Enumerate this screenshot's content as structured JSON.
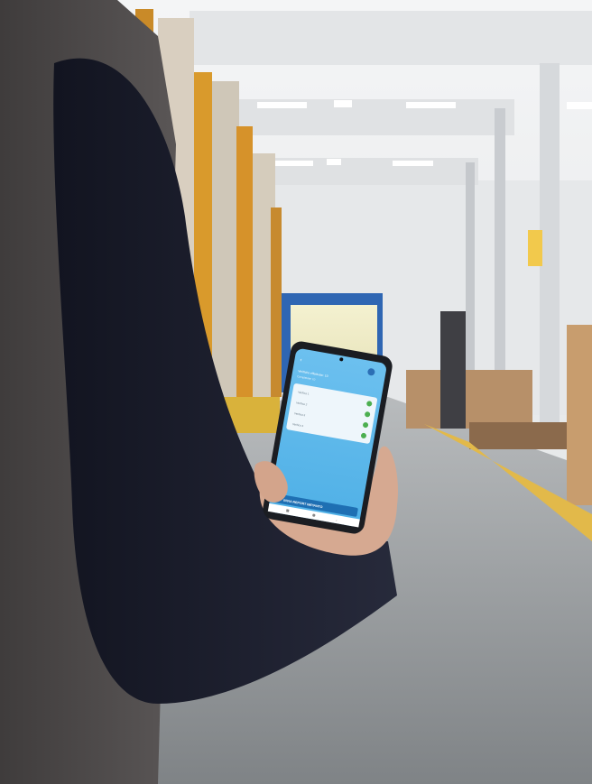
{
  "scene": {
    "description_tags": [
      "warehouse-aisle",
      "worker",
      "smartphone"
    ],
    "colors": {
      "floor": "#8f9396",
      "wall": "#e6e8ea",
      "ceiling": "#e9ebed",
      "jacket": "#504d4d",
      "sleeve": "#1f2130",
      "skin": "#d6a991",
      "phone_body": "#1b1d22",
      "phone_screen": "#5db7ea",
      "yellow_line": "#e2b94a",
      "door_frame": "#2f66b3"
    }
  },
  "phone_app": {
    "header_title": "Verifiche effettuate: 10",
    "header_subtitle": "Completate: 10",
    "action_button_label": "INVIA REPORT IMPIANTO",
    "list_items": [
      {
        "label": "Verifica 1",
        "status_icon": "check-circle-icon"
      },
      {
        "label": "Verifica 2",
        "status_icon": "check-circle-icon"
      },
      {
        "label": "Verifica 3",
        "status_icon": "check-circle-icon"
      },
      {
        "label": "Verifica 4",
        "status_icon": "check-circle-icon"
      }
    ]
  }
}
